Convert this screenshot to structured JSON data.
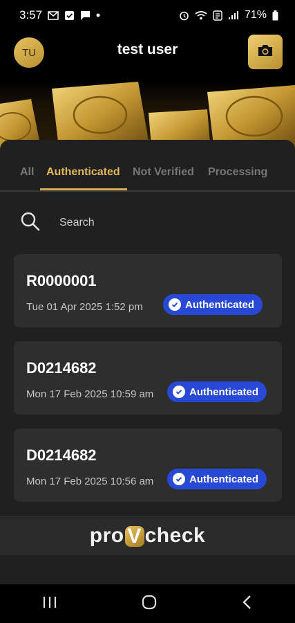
{
  "status_bar": {
    "time": "3:57",
    "battery": "71%"
  },
  "header": {
    "avatar_initials": "TU",
    "title": "test user"
  },
  "tabs": [
    {
      "label": "All",
      "active": false
    },
    {
      "label": "Authenticated",
      "active": true
    },
    {
      "label": "Not Verified",
      "active": false
    },
    {
      "label": "Processing",
      "active": false
    }
  ],
  "search": {
    "placeholder": "Search"
  },
  "items": [
    {
      "id": "R0000001",
      "date": "Tue 01 Apr 2025 1:52 pm",
      "status": "Authenticated"
    },
    {
      "id": "D0214682",
      "date": "Mon 17 Feb 2025 10:59 am",
      "status": "Authenticated"
    },
    {
      "id": "D0214682",
      "date": "Mon 17 Feb 2025 10:56 am",
      "status": "Authenticated"
    }
  ],
  "brand": {
    "prefix": "pro",
    "mark": "V",
    "suffix": "check"
  },
  "colors": {
    "accent_gold": "#d8ad52",
    "badge_blue": "#2749d6"
  }
}
